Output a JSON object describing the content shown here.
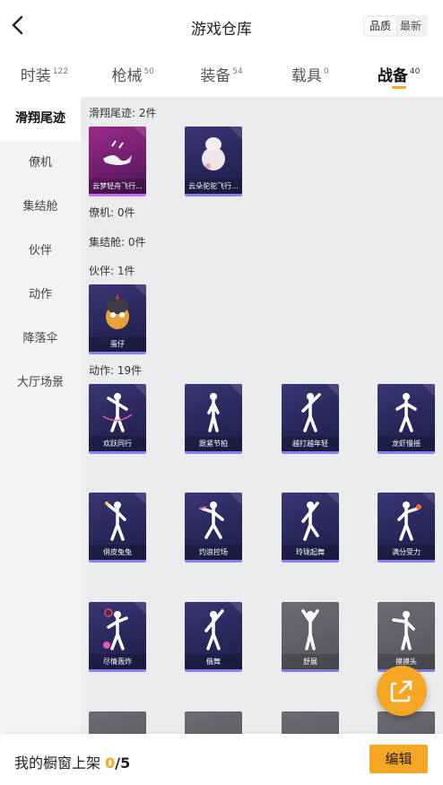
{
  "header": {
    "title": "游戏仓库",
    "sort": [
      "品质",
      "最新"
    ]
  },
  "tabs": [
    {
      "label": "时装",
      "count": "122"
    },
    {
      "label": "枪械",
      "count": "50"
    },
    {
      "label": "装备",
      "count": "54"
    },
    {
      "label": "载具",
      "count": "0"
    },
    {
      "label": "战备",
      "count": "40"
    }
  ],
  "sidebar": [
    "滑翔尾迹",
    "僚机",
    "集结舱",
    "伙伴",
    "动作",
    "降落伞",
    "大厅场景"
  ],
  "sections": {
    "glide": "滑翔尾迹: 2件",
    "wingman": "僚机: 0件",
    "assembly": "集结舱: 0件",
    "partner": "伙伴: 1件",
    "action": "动作: 19件"
  },
  "items": {
    "glide": [
      "云梦轻舟飞行...",
      "云朵驼驼飞行..."
    ],
    "partner": [
      "蛋仔"
    ],
    "actions": [
      "欢跃同行",
      "跟紧节拍",
      "越打越年轻",
      "龙虾慢摇",
      "俏皮兔兔",
      "灼浪控场",
      "玲珑起舞",
      "满分受力",
      "尽情轰炸",
      "俄舞",
      "舒展",
      "摸摸头"
    ]
  },
  "footer": {
    "label": "我的橱窗上架 ",
    "count": "0",
    "total": "/5",
    "edit": "编辑"
  },
  "colors": {
    "accent": "#f5a623"
  }
}
